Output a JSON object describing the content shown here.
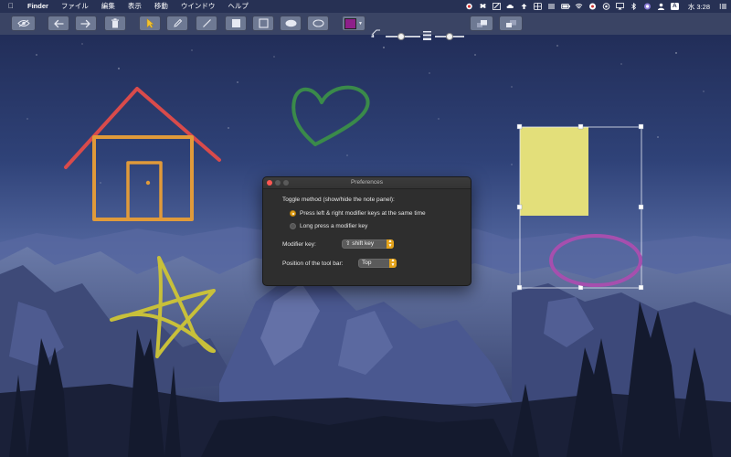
{
  "menubar": {
    "apple_icon": "apple-logo-icon",
    "items": [
      "Finder",
      "ファイル",
      "編集",
      "表示",
      "移動",
      "ウインドウ",
      "ヘルプ"
    ],
    "status_icons": [
      "creative-cloud-icon",
      "dropbox-icon",
      "screen-edit-icon",
      "cloud-icon",
      "upload-icon",
      "grid-icon",
      "list-icon",
      "battery-icon",
      "wifi-icon",
      "flag-icon",
      "record-icon",
      "airplay-icon",
      "bluetooth-icon",
      "siri-icon",
      "user-icon",
      "text-input-icon",
      "notification-center-icon"
    ],
    "input_source": "A",
    "clock": "水 3:28"
  },
  "toolbar": {
    "buttons": [
      "eye-icon",
      "undo-arrow-icon",
      "redo-arrow-icon",
      "trash-icon",
      "pointer-icon",
      "pen-icon",
      "line-icon",
      "filled-rect-icon",
      "rect-icon",
      "filled-ellipse-icon",
      "ellipse-icon",
      "color-swatch-icon",
      "opacity-slider",
      "stroke-width-slider",
      "bring-front-icon",
      "send-back-icon"
    ],
    "color_value": "#8e1f8a",
    "opacity_level": 0.45,
    "stroke_level": 0.5
  },
  "drawings": {
    "house_color": "#d94b4b",
    "house_body_color": "#e09a3a",
    "heart_color": "#3a8a4a",
    "star_color": "#c8c03a",
    "note_color": "#e3df7a",
    "ellipse_color": "#a64fae"
  },
  "preferences": {
    "title": "Preferences",
    "toggle_label": "Toggle method (show/hide the note panel):",
    "option_1": "Press left & right modifier keys at the same time",
    "option_2": "Long press a modifier key",
    "option_1_selected": true,
    "modifier_label": "Modifier key:",
    "modifier_value": "⇧ shift key",
    "position_label": "Position of the tool bar:",
    "position_value": "Top"
  }
}
